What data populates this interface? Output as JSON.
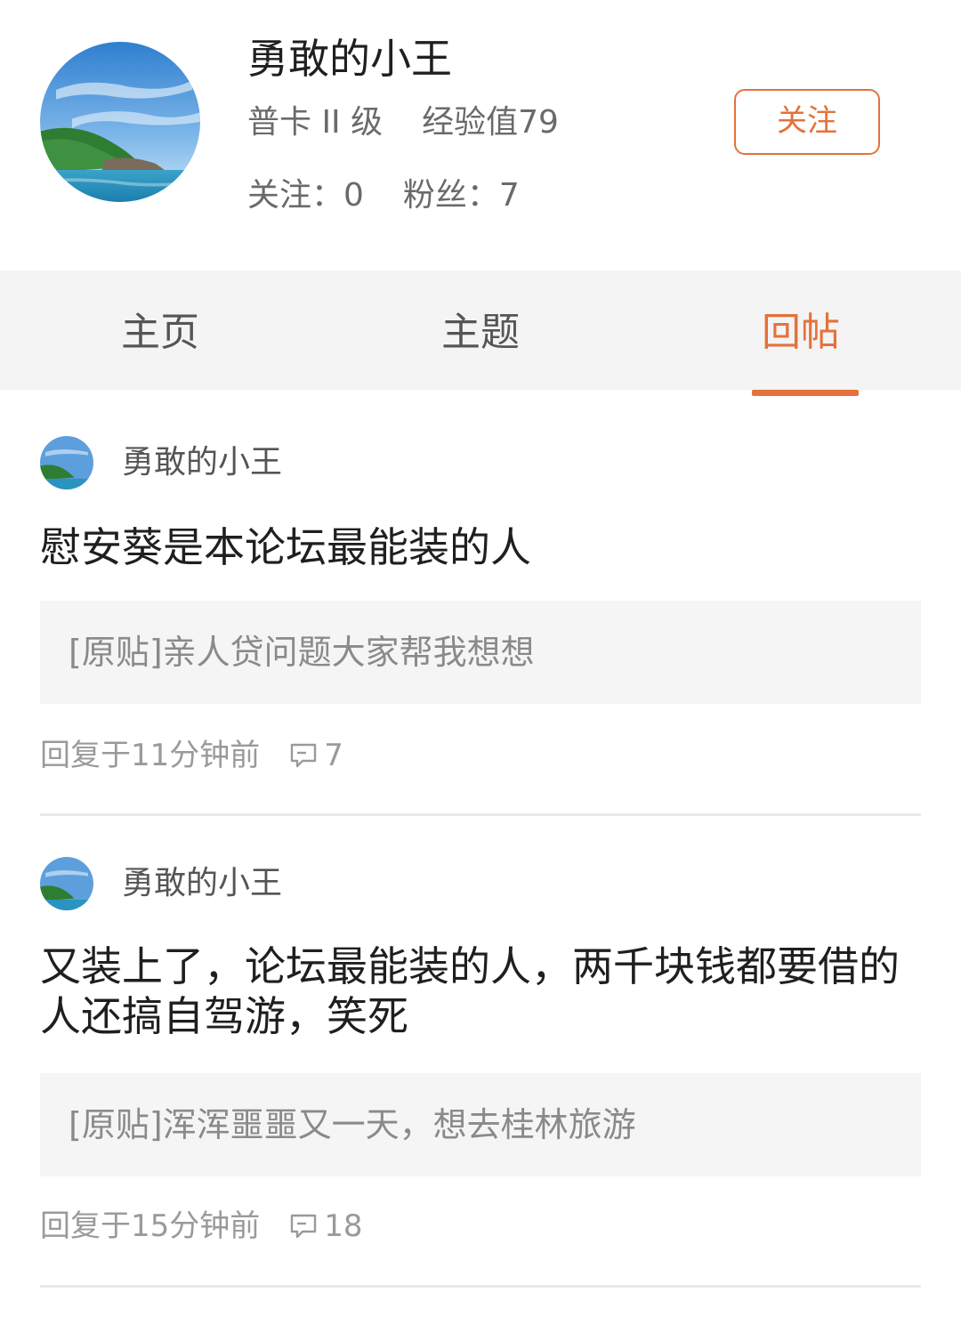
{
  "profile": {
    "name": "勇敢的小王",
    "level": "普卡 II 级",
    "experience": "经验值79",
    "following": "关注：0",
    "fans": "粉丝：7",
    "follow_button": "关注",
    "avatar_icon": "landscape-avatar-icon"
  },
  "tabs": [
    {
      "label": "主页",
      "active": false
    },
    {
      "label": "主题",
      "active": false
    },
    {
      "label": "回帖",
      "active": true
    }
  ],
  "posts": [
    {
      "author": "勇敢的小王",
      "content": "慰安葵是本论坛最能装的人",
      "quote": "[原贴]亲人贷问题大家帮我想想",
      "reply_time": "回复于11分钟前",
      "comment_count": "7"
    },
    {
      "author": "勇敢的小王",
      "content": "又装上了，论坛最能装的人，两千块钱都要借的人还搞自驾游，笑死",
      "quote": "[原贴]浑浑噩噩又一天，想去桂林旅游",
      "reply_time": "回复于15分钟前",
      "comment_count": "18"
    }
  ],
  "colors": {
    "accent": "#e4723a",
    "tab_background": "#f4f4f4",
    "quote_background": "#f5f5f5",
    "divider": "#e8e8e8"
  }
}
